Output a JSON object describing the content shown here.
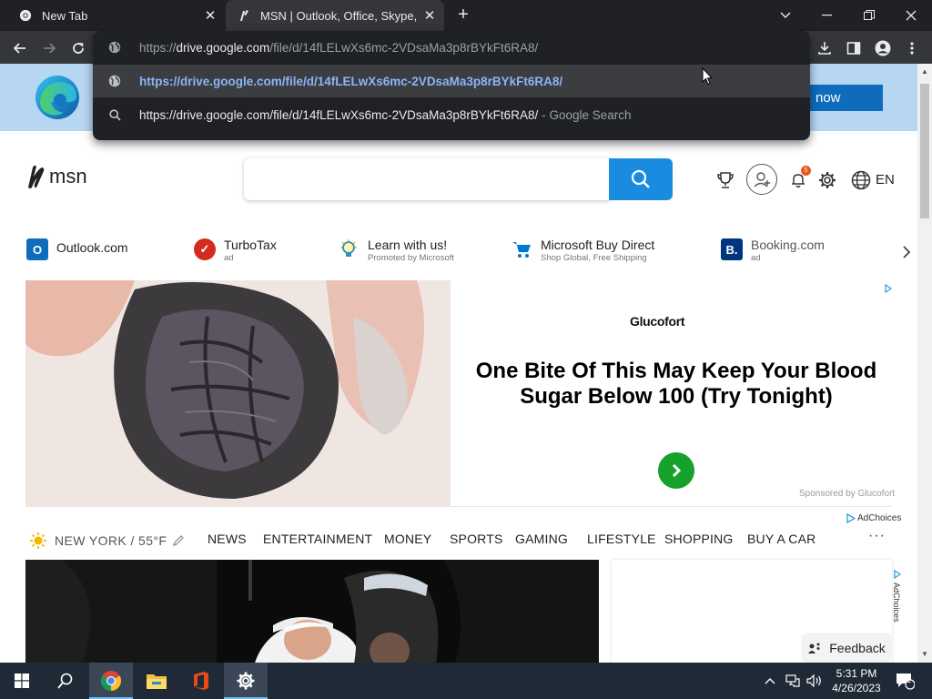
{
  "browser": {
    "tabs": [
      {
        "title": "New Tab",
        "active": false
      },
      {
        "title": "MSN | Outlook, Office, Skype, Bing",
        "active": true
      }
    ],
    "omnibox": {
      "input_value": "https://drive.google.com/file/d/14fLELwXs6mc-2VDsaMa3p8rBYkFt6RA8/",
      "input_prefix": "https://",
      "input_host": "drive.google.com",
      "input_path": "/file/d/14fLELwXs6mc-2VDsaMa3p8rBYkFt6RA8/",
      "suggestions": [
        {
          "text": "https://drive.google.com/file/d/14fLELwXs6mc-2VDsaMa3p8rBYkFt6RA8/",
          "icon": "globe-icon"
        },
        {
          "text": "https://drive.google.com/file/d/14fLELwXs6mc-2VDsaMa3p8rBYkFt6RA8/",
          "suffix": "- Google Search",
          "icon": "search-icon"
        }
      ]
    }
  },
  "page": {
    "banner": {
      "button_label": "now"
    },
    "msn_logo": "msn",
    "search": {
      "placeholder": ""
    },
    "language": "EN",
    "notification_count": "5",
    "quick_links": [
      {
        "label": "Outlook.com",
        "sub": "",
        "color": "#0f6cbd",
        "glyph": "O"
      },
      {
        "label": "TurboTax",
        "sub": "ad",
        "color": "#d52b1e",
        "glyph": "✓"
      },
      {
        "label": "Learn with us!",
        "sub": "Promoted by Microsoft",
        "color": "#2a8fbd",
        "glyph": "💡"
      },
      {
        "label": "Microsoft Buy Direct",
        "sub": "Shop Global, Free Shipping",
        "color": "#0078d4",
        "glyph": "🛒"
      },
      {
        "label": "Booking.com",
        "sub": "ad",
        "color": "#003580",
        "glyph": "B."
      }
    ],
    "ad": {
      "brand": "Glucofort",
      "headline": "One Bite Of This May Keep Your Blood Sugar Below 100 (Try Tonight)",
      "sponsor": "Sponsored by Glucofort",
      "adchoices": "AdChoices"
    },
    "weather": {
      "location": "NEW YORK / 55°F"
    },
    "categories": [
      "NEWS",
      "ENTERTAINMENT",
      "MONEY",
      "SPORTS",
      "GAMING",
      "LIFESTYLE",
      "SHOPPING",
      "BUY A CAR"
    ],
    "more": "···",
    "side_adchoices": "AdChoices",
    "feedback": "Feedback"
  },
  "taskbar": {
    "time": "5:31 PM",
    "date": "4/26/2023",
    "notification_count": "1"
  }
}
